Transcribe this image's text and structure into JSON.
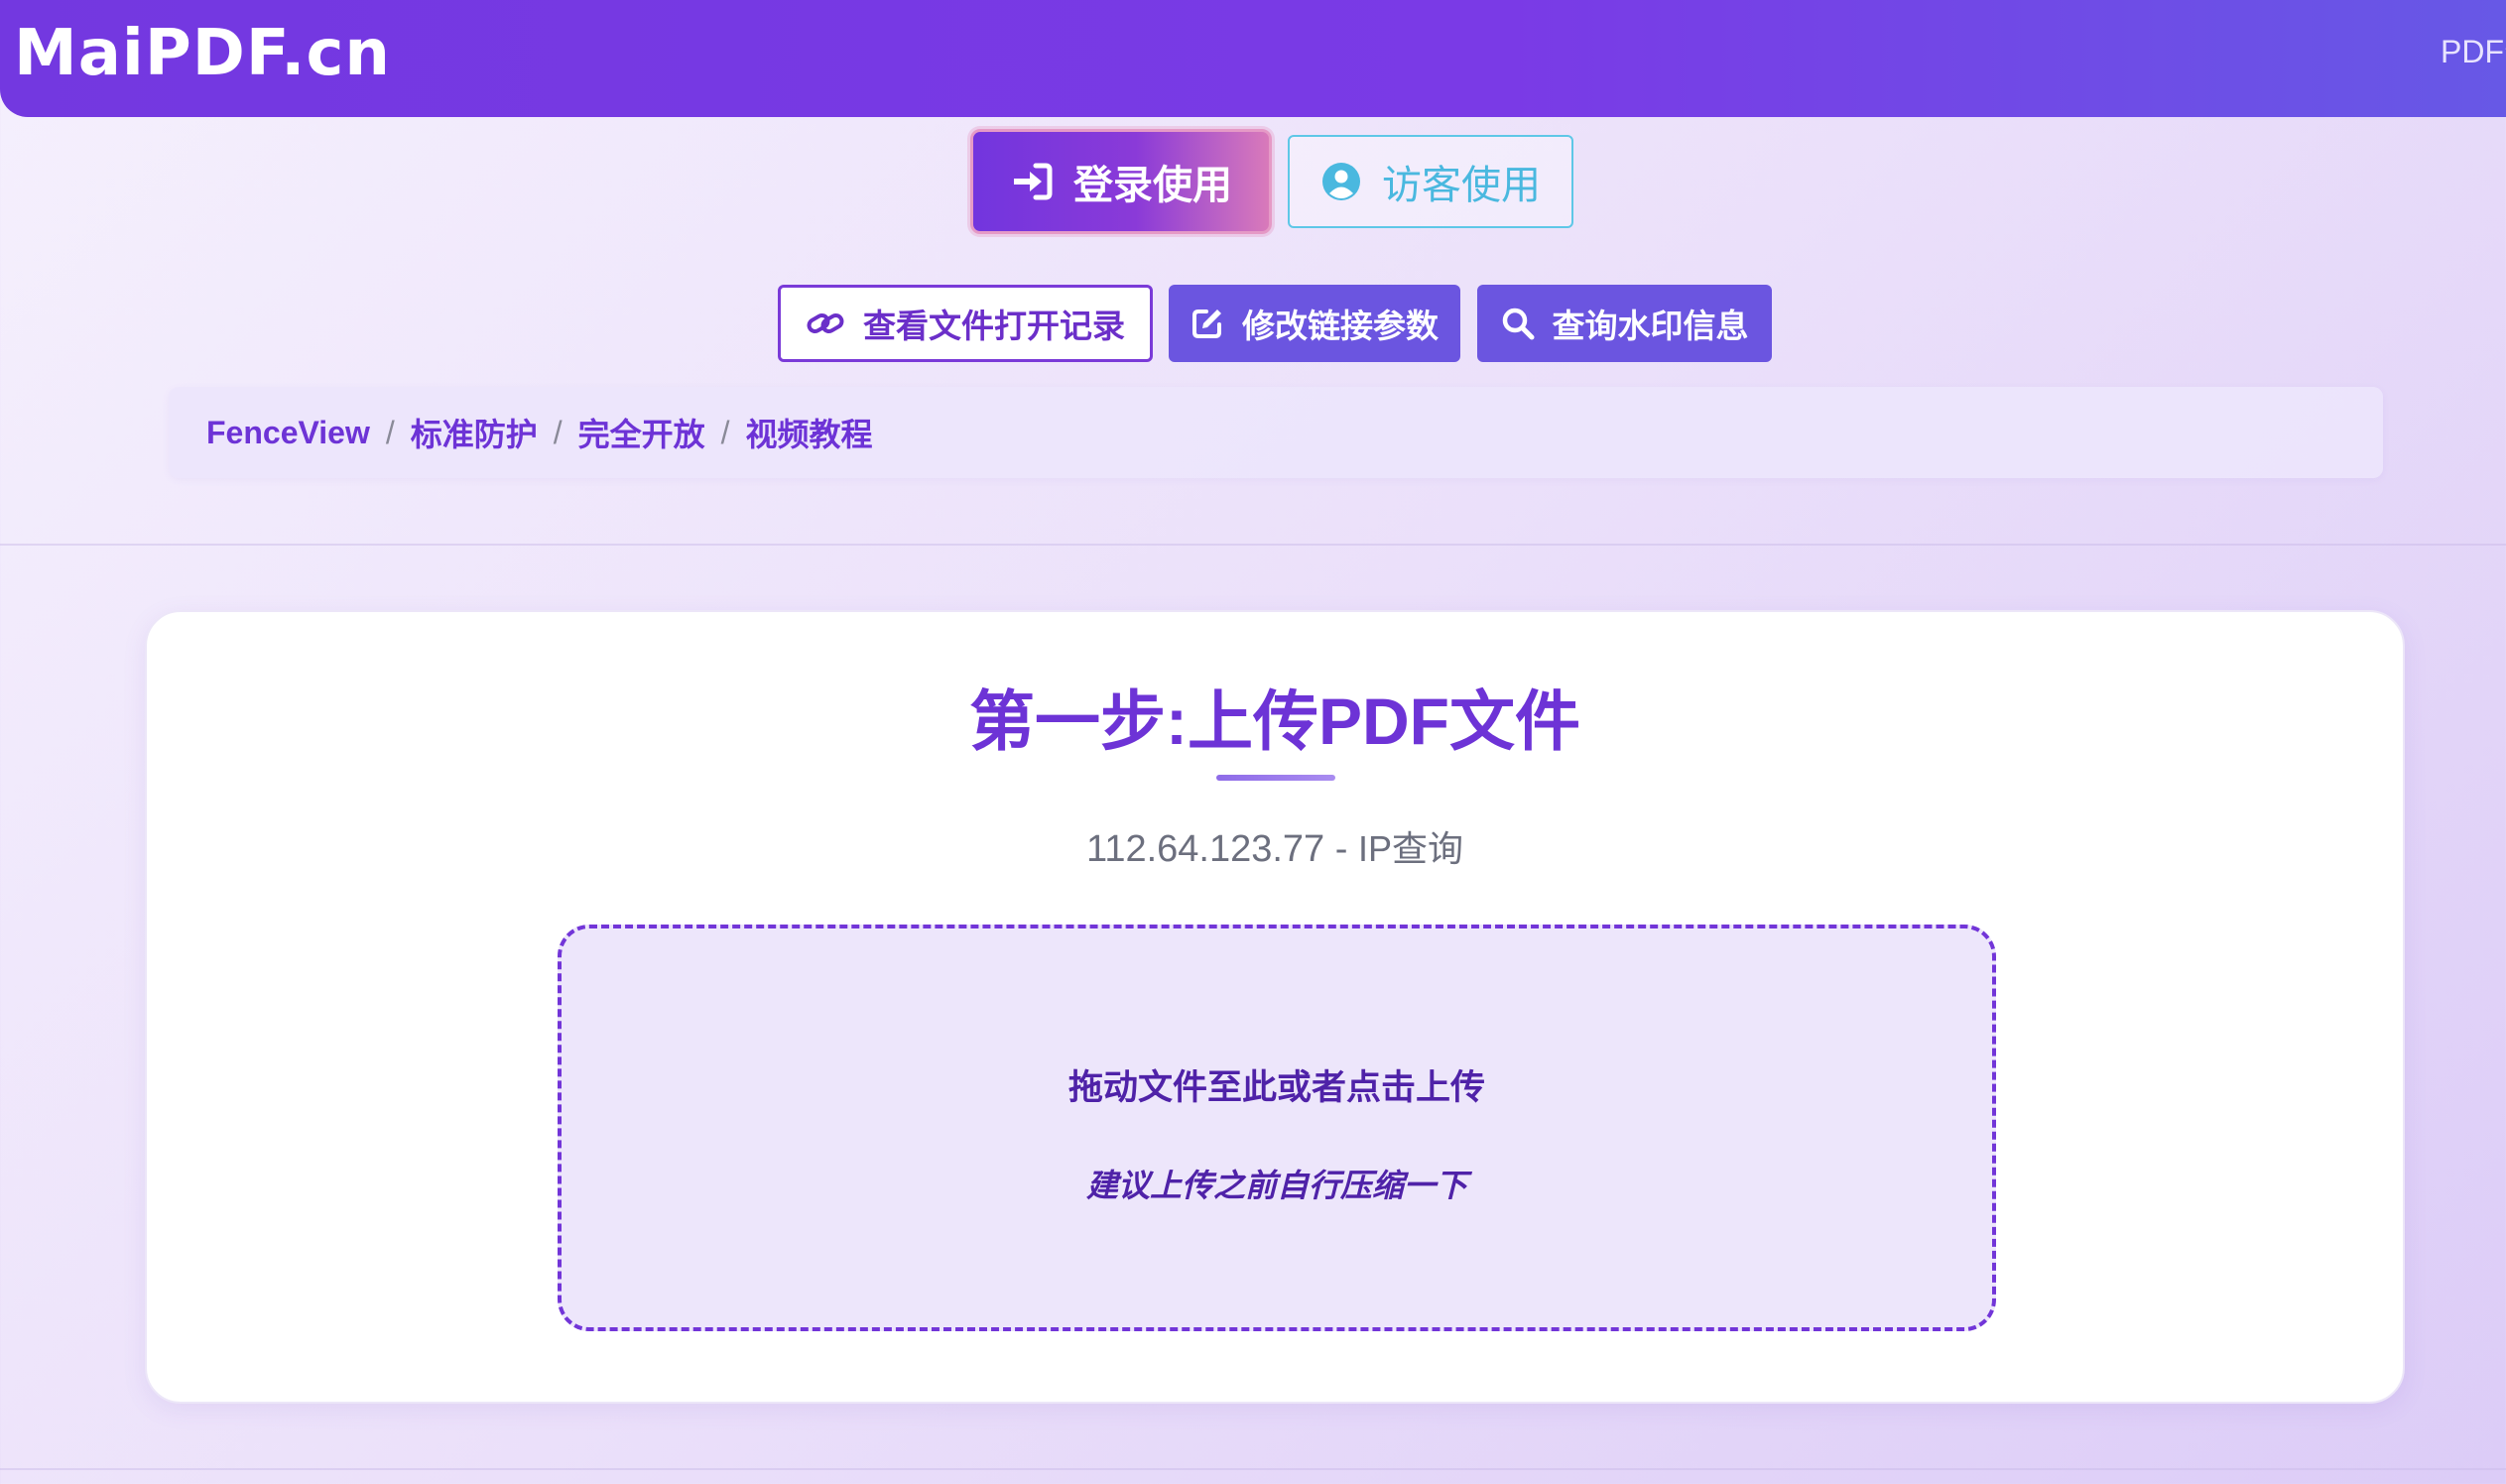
{
  "header": {
    "brand": "MaiPDF.cn",
    "nav_right": "PDF分"
  },
  "auth": {
    "login_label": "登录使用",
    "guest_label": "访客使用"
  },
  "tools": {
    "view_records_label": "查看文件打开记录",
    "edit_params_label": "修改链接参数",
    "watermark_query_label": "查询水印信息"
  },
  "breadcrumb": {
    "items": [
      "FenceView",
      "标准防护",
      "完全开放",
      "视频教程"
    ],
    "separator": "/"
  },
  "upload": {
    "title": "第一步:上传PDF文件",
    "ip": "112.64.123.77",
    "ip_separator": " - ",
    "ip_query_label": "IP查询",
    "drop_main": "拖动文件至此或者点击上传",
    "drop_hint": "建议上传之前自行压缩一下"
  },
  "colors": {
    "primary": "#6d33d6",
    "header_gradient_start": "#7338e0",
    "header_gradient_end": "#6758e6",
    "guest_accent": "#4ab8df",
    "tool_button": "#6b55e0",
    "dropzone_border": "#7235d8",
    "dropzone_bg": "#ede6fb"
  },
  "icons": {
    "login": "sign-in-icon",
    "guest": "user-circle-icon",
    "records": "link-icon",
    "edit": "edit-icon",
    "search": "search-icon"
  }
}
